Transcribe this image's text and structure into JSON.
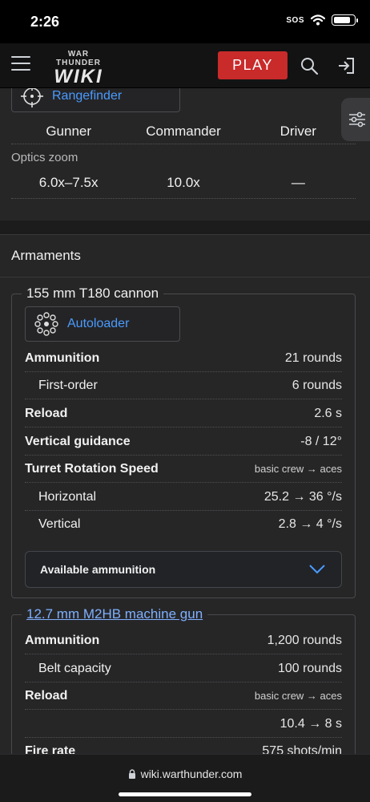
{
  "status_bar": {
    "time": "2:26",
    "sos": "SOS",
    "battery_level": 0.85
  },
  "header": {
    "logo_top": "WAR THUNDER",
    "logo_main": "WIKI",
    "play_label": "PLAY",
    "icons": [
      "hamburger-menu-icon",
      "search-icon",
      "login-icon"
    ]
  },
  "optics": {
    "rangefinder_label": "Rangefinder",
    "crew": [
      "Gunner",
      "Commander",
      "Driver"
    ],
    "optics_zoom_label": "Optics zoom",
    "zoom_values": [
      "6.0x–7.5x",
      "10.0x",
      "—"
    ]
  },
  "armaments": {
    "title": "Armaments",
    "cannon": {
      "name": "155 mm T180 cannon",
      "autoloader_label": "Autoloader",
      "rows": [
        {
          "label": "Ammunition",
          "value": "21 rounds"
        },
        {
          "label": "First-order",
          "value": "6 rounds"
        },
        {
          "label": "Reload",
          "value": "2.6 s"
        },
        {
          "label": "Vertical guidance",
          "value": "-8 / 12°"
        },
        {
          "label": "Turret Rotation Speed",
          "value": "basic crew → aces"
        },
        {
          "label": "Horizontal",
          "value": "25.2 → 36 °/s"
        },
        {
          "label": "Vertical",
          "value": "2.8 → 4 °/s"
        }
      ],
      "available_ammo_label": "Available ammunition"
    },
    "machine_gun": {
      "name": "12.7 mm M2HB machine gun",
      "rows": [
        {
          "label": "Ammunition",
          "value": "1,200 rounds"
        },
        {
          "label": "Belt capacity",
          "value": "100 rounds"
        },
        {
          "label": "Reload",
          "value": "basic crew → aces"
        },
        {
          "label": "",
          "value": "10.4 → 8 s"
        },
        {
          "label": "Fire rate",
          "value": "575 shots/min"
        }
      ]
    }
  },
  "browser": {
    "url": "wiki.warthunder.com"
  },
  "colors": {
    "play_red": "#c92a2a",
    "link_blue": "#4a9bff"
  }
}
